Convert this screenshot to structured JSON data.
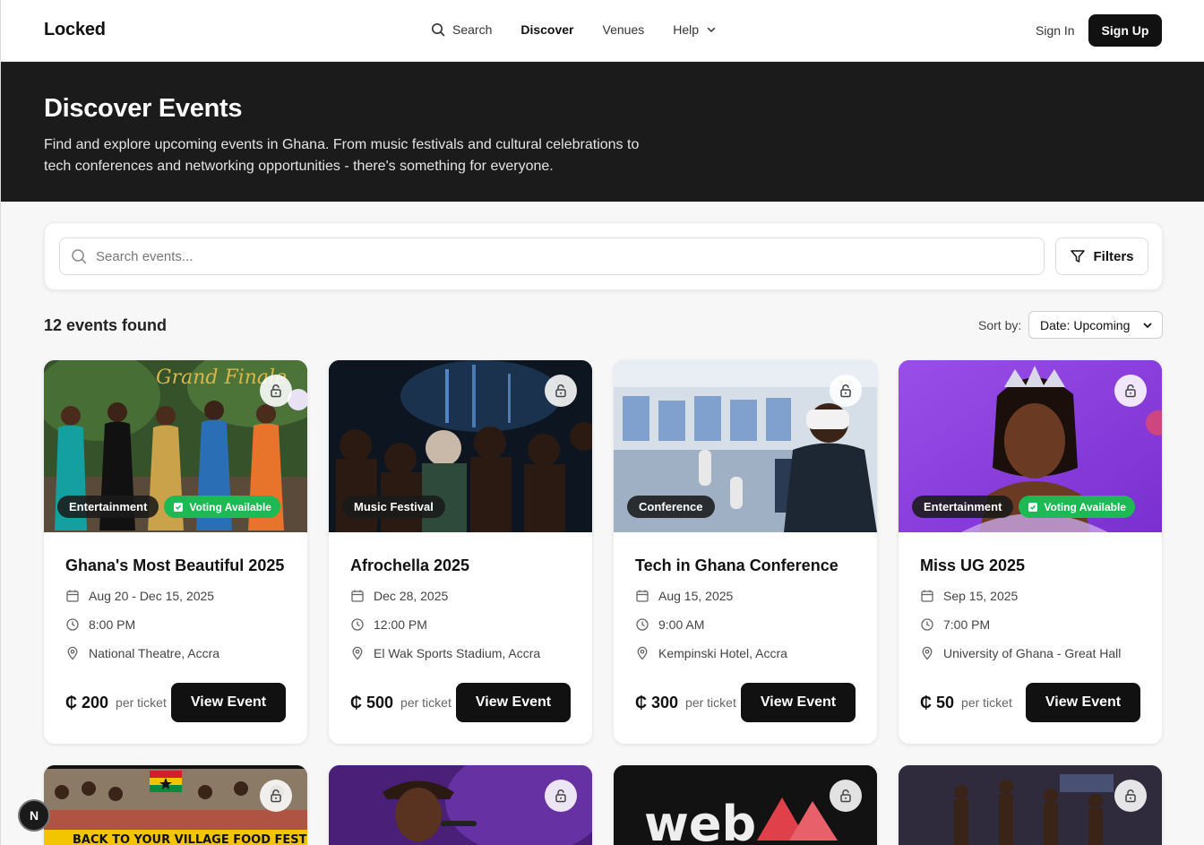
{
  "nav": {
    "logo": "Locked",
    "search": "Search",
    "discover": "Discover",
    "venues": "Venues",
    "help": "Help",
    "sign_in": "Sign In",
    "sign_up": "Sign Up"
  },
  "hero": {
    "title": "Discover Events",
    "subtitle": "Find and explore upcoming events in Ghana. From music festivals and cultural celebrations to tech conferences and networking opportunities - there's something for everyone."
  },
  "search": {
    "placeholder": "Search events...",
    "filters_label": "Filters"
  },
  "results": {
    "count_text": "12 events found",
    "sort_label": "Sort by:",
    "sort_value": "Date: Upcoming"
  },
  "events": [
    {
      "title": "Ghana's Most Beautiful 2025",
      "category": "Entertainment",
      "voting": "Voting Available",
      "date": "Aug 20 - Dec 15, 2025",
      "time": "8:00 PM",
      "venue": "National Theatre, Accra",
      "price": "₵ 200",
      "per": "per ticket",
      "button": "View Event",
      "overlay_text": "Grand Finale"
    },
    {
      "title": "Afrochella 2025",
      "category": "Music Festival",
      "date": "Dec 28, 2025",
      "time": "12:00 PM",
      "venue": "El Wak Sports Stadium, Accra",
      "price": "₵ 500",
      "per": "per ticket",
      "button": "View Event"
    },
    {
      "title": "Tech in Ghana Conference",
      "category": "Conference",
      "date": "Aug 15, 2025",
      "time": "9:00 AM",
      "venue": "Kempinski Hotel, Accra",
      "price": "₵ 300",
      "per": "per ticket",
      "button": "View Event"
    },
    {
      "title": "Miss UG 2025",
      "category": "Entertainment",
      "voting": "Voting Available",
      "date": "Sep 15, 2025",
      "time": "7:00 PM",
      "venue": "University of Ghana - Great Hall",
      "price": "₵ 50",
      "per": "per ticket",
      "button": "View Event"
    }
  ],
  "more_events": [
    {
      "overlay_text": "BACK TO YOUR VILLAGE FOOD FESTIVAL"
    },
    {
      "overlay_text": ""
    },
    {
      "overlay_text": "web"
    },
    {
      "overlay_text": ""
    }
  ],
  "fab": {
    "label": "N"
  }
}
